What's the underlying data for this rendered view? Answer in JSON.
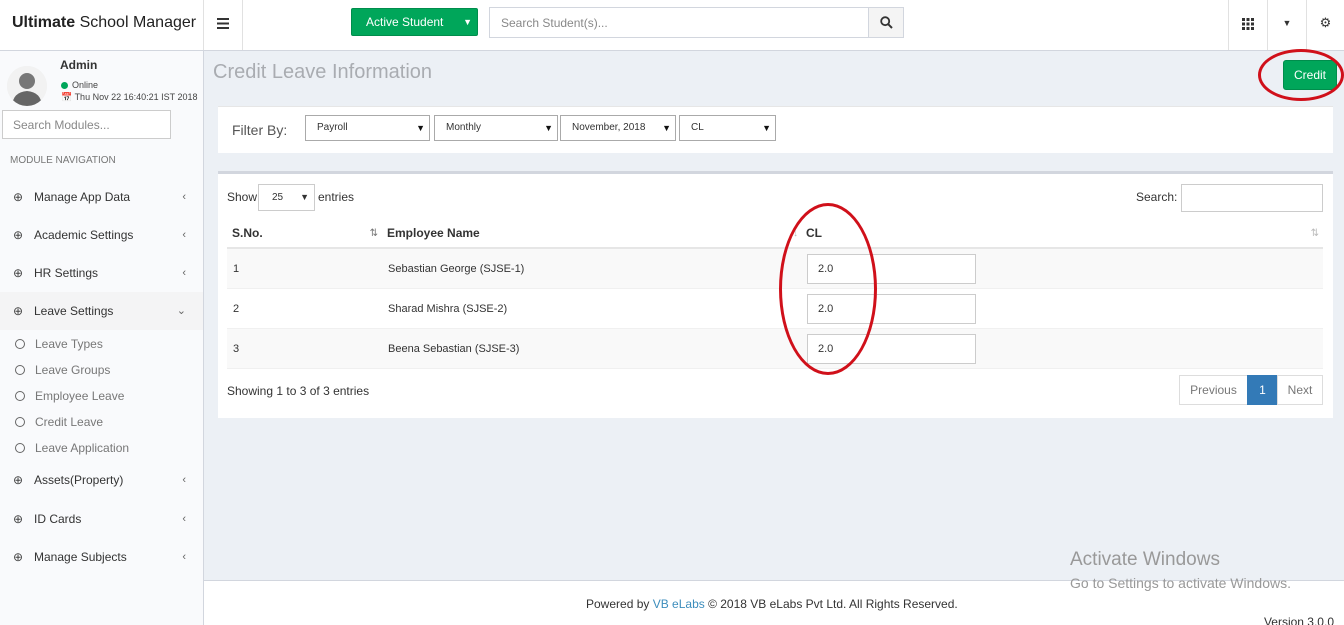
{
  "header": {
    "brand_bold": "Ultimate",
    "brand_rest": " School Manager",
    "menu_icon": "hamburger-icon",
    "active_student_label": "Active Student",
    "search_placeholder": "Search Student(s)..."
  },
  "user": {
    "name": "Admin",
    "status": "Online",
    "datetime": "Thu Nov 22 16:40:21 IST 2018"
  },
  "sidebar": {
    "search_placeholder": "Search Modules...",
    "nav_header": "MODULE NAVIGATION",
    "items": [
      {
        "label": "Manage App Data"
      },
      {
        "label": "Academic Settings"
      },
      {
        "label": "HR Settings"
      },
      {
        "label": "Leave Settings"
      },
      {
        "label": "Assets(Property)"
      },
      {
        "label": "ID Cards"
      },
      {
        "label": "Manage Subjects"
      }
    ],
    "leave_sub_items": [
      {
        "label": "Leave Types"
      },
      {
        "label": "Leave Groups"
      },
      {
        "label": "Employee Leave"
      },
      {
        "label": "Credit Leave"
      },
      {
        "label": "Leave Application"
      }
    ]
  },
  "page": {
    "title": "Credit Leave Information",
    "credit_button": "Credit"
  },
  "filter": {
    "label": "Filter By:",
    "selects": [
      "Payroll",
      "Monthly",
      "November, 2018",
      "CL"
    ]
  },
  "table": {
    "show_label": "Show",
    "entries_value": "25",
    "entries_label": "entries",
    "search_label": "Search:",
    "columns": [
      "S.No.",
      "Employee Name",
      "CL"
    ],
    "rows": [
      {
        "sno": "1",
        "name": "Sebastian George (SJSE-1)",
        "cl": "2.0"
      },
      {
        "sno": "2",
        "name": "Sharad Mishra (SJSE-2)",
        "cl": "2.0"
      },
      {
        "sno": "3",
        "name": "Beena Sebastian (SJSE-3)",
        "cl": "2.0"
      }
    ],
    "showing": "Showing 1 to 3 of 3 entries",
    "pagination": {
      "previous": "Previous",
      "current": "1",
      "next": "Next"
    }
  },
  "footer": {
    "powered_by": "Powered by ",
    "vb_link": "VB eLabs",
    "rights": " © 2018 VB eLabs Pvt Ltd. All Rights Reserved.",
    "version": "Version 3.0.0"
  },
  "watermark": {
    "line1": "Activate Windows",
    "line2": "Go to Settings to activate Windows."
  },
  "colors": {
    "green": "#00a65a",
    "blue": "#337ab7",
    "annotation_red": "#d0101a"
  }
}
